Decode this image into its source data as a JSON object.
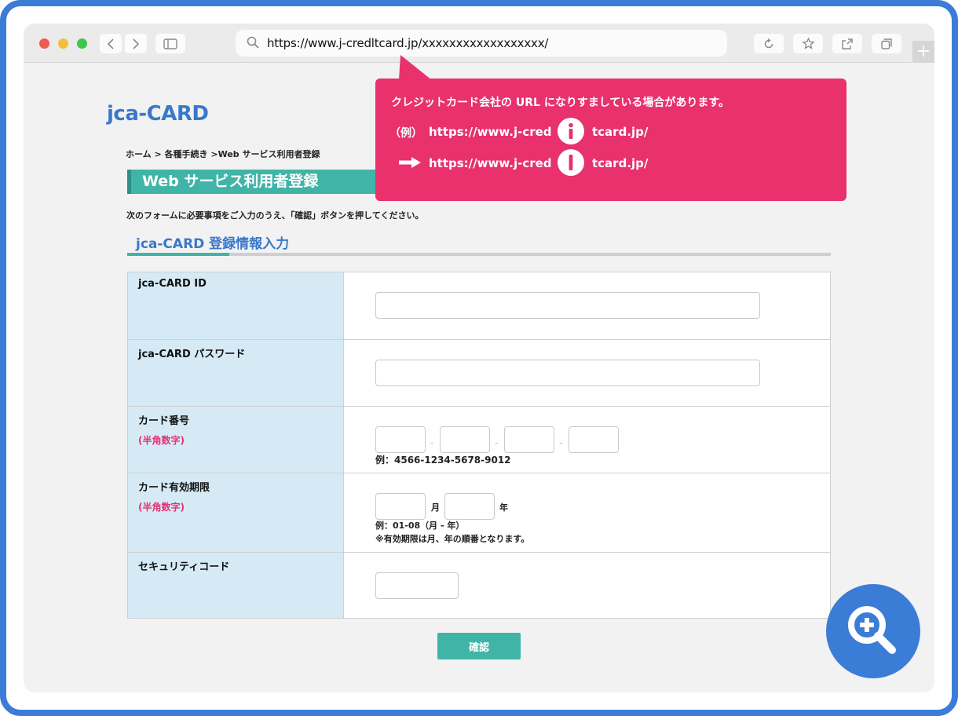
{
  "browser": {
    "url": "https://www.j-credltcard.jp/xxxxxxxxxxxxxxxxxx/",
    "new_tab": "+"
  },
  "site": {
    "logo": "jca-CARD",
    "breadcrumb": "ホーム > 各種手続き >Web サービス利用者登録",
    "page_title": "Web サービス利用者登録",
    "intro": "次のフォームに必要事項をご入力のうえ、「確認」ボタンを押してください。",
    "section_title": "jca-CARD 登録情報入力"
  },
  "form": {
    "id_label": "jca-CARD ID",
    "password_label": "jca-CARD パスワード",
    "card_number_label": "カード番号",
    "card_number_note": "(半角数字)",
    "card_number_dash": "-",
    "card_number_hint": "例：4566-1234-5678-9012",
    "expiry_label": "カード有効期限",
    "expiry_note": "(半角数字)",
    "expiry_month_unit": "月",
    "expiry_year_unit": "年",
    "expiry_hint": "例：01-08（月 - 年）",
    "expiry_hint2": "※有効期限は月、年の順番となります。",
    "security_label": "セキュリティコード",
    "submit_label": "確認"
  },
  "callout": {
    "message": "クレジットカード会社の URL になりすましている場合があります。",
    "example_label": "（例）",
    "url_prefix": "https://www.j-cred",
    "url_suffix": "tcard.jp/",
    "colors": {
      "bg": "#e8316d",
      "text": "#ffffff"
    }
  },
  "colors": {
    "frame": "#3b7dd6",
    "accent_teal": "#3fb4a7",
    "link_blue": "#3a78c9",
    "label_bg": "#d6eaf6",
    "note_pink": "#e43172"
  },
  "icons": [
    "search-icon",
    "back-icon",
    "forward-icon",
    "sidebar-icon",
    "reload-icon",
    "star-icon",
    "share-icon",
    "tabs-icon",
    "arrow-right-icon",
    "info-i-icon",
    "letter-l-icon",
    "zoom-in-icon"
  ]
}
